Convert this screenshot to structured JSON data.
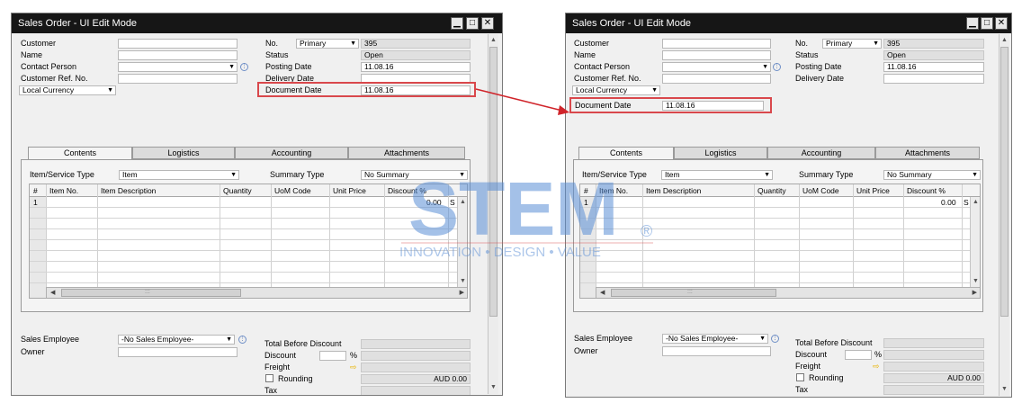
{
  "window": {
    "title": "Sales Order - UI Edit Mode",
    "min_glyph": "▁",
    "max_glyph": "□",
    "close_glyph": "✕"
  },
  "header": {
    "customer_label": "Customer",
    "name_label": "Name",
    "contact_label": "Contact Person",
    "ref_label": "Customer Ref. No.",
    "currency_value": "Local Currency",
    "no_label": "No.",
    "series_value": "Primary",
    "doc_number": "395",
    "status_label": "Status",
    "status_value": "Open",
    "posting_label": "Posting Date",
    "posting_value": "11.08.16",
    "delivery_label": "Delivery Date",
    "docdate_label": "Document Date",
    "docdate_value": "11.08.16"
  },
  "tabs": [
    "Contents",
    "Logistics",
    "Accounting",
    "Attachments"
  ],
  "contents": {
    "item_type_label": "Item/Service Type",
    "item_type_value": "Item",
    "summary_label": "Summary Type",
    "summary_value": "No Summary",
    "columns": [
      "#",
      "Item No.",
      "Item Description",
      "Quantity",
      "UoM Code",
      "Unit Price",
      "Discount %",
      "S"
    ],
    "row1": {
      "num": "1",
      "discount": "0.00",
      "extra": "S"
    },
    "scroll_grip": ":::"
  },
  "footer": {
    "sales_emp_label": "Sales Employee",
    "sales_emp_value": "-No Sales Employee-",
    "owner_label": "Owner",
    "total_before_label": "Total Before Discount",
    "discount_label": "Discount",
    "percent": "%",
    "freight_label": "Freight",
    "rounding_label": "Rounding",
    "rounding_value": "AUD 0.00",
    "tax_label": "Tax"
  },
  "watermark": {
    "brand": "STEM",
    "registered": "®",
    "tagline": "INNOVATION • DESIGN • VALUE"
  },
  "colors": {
    "highlight": "#d9484c",
    "arrow": "#d0242a",
    "titlebar": "#161616",
    "watermark": "#5a8ed6"
  },
  "icons": {
    "dropdown": "▼",
    "info": "⋮",
    "scroll_up": "▲",
    "scroll_down": "▼",
    "scroll_left": "◀",
    "scroll_right": "▶",
    "freight_arrow": "⇨"
  }
}
